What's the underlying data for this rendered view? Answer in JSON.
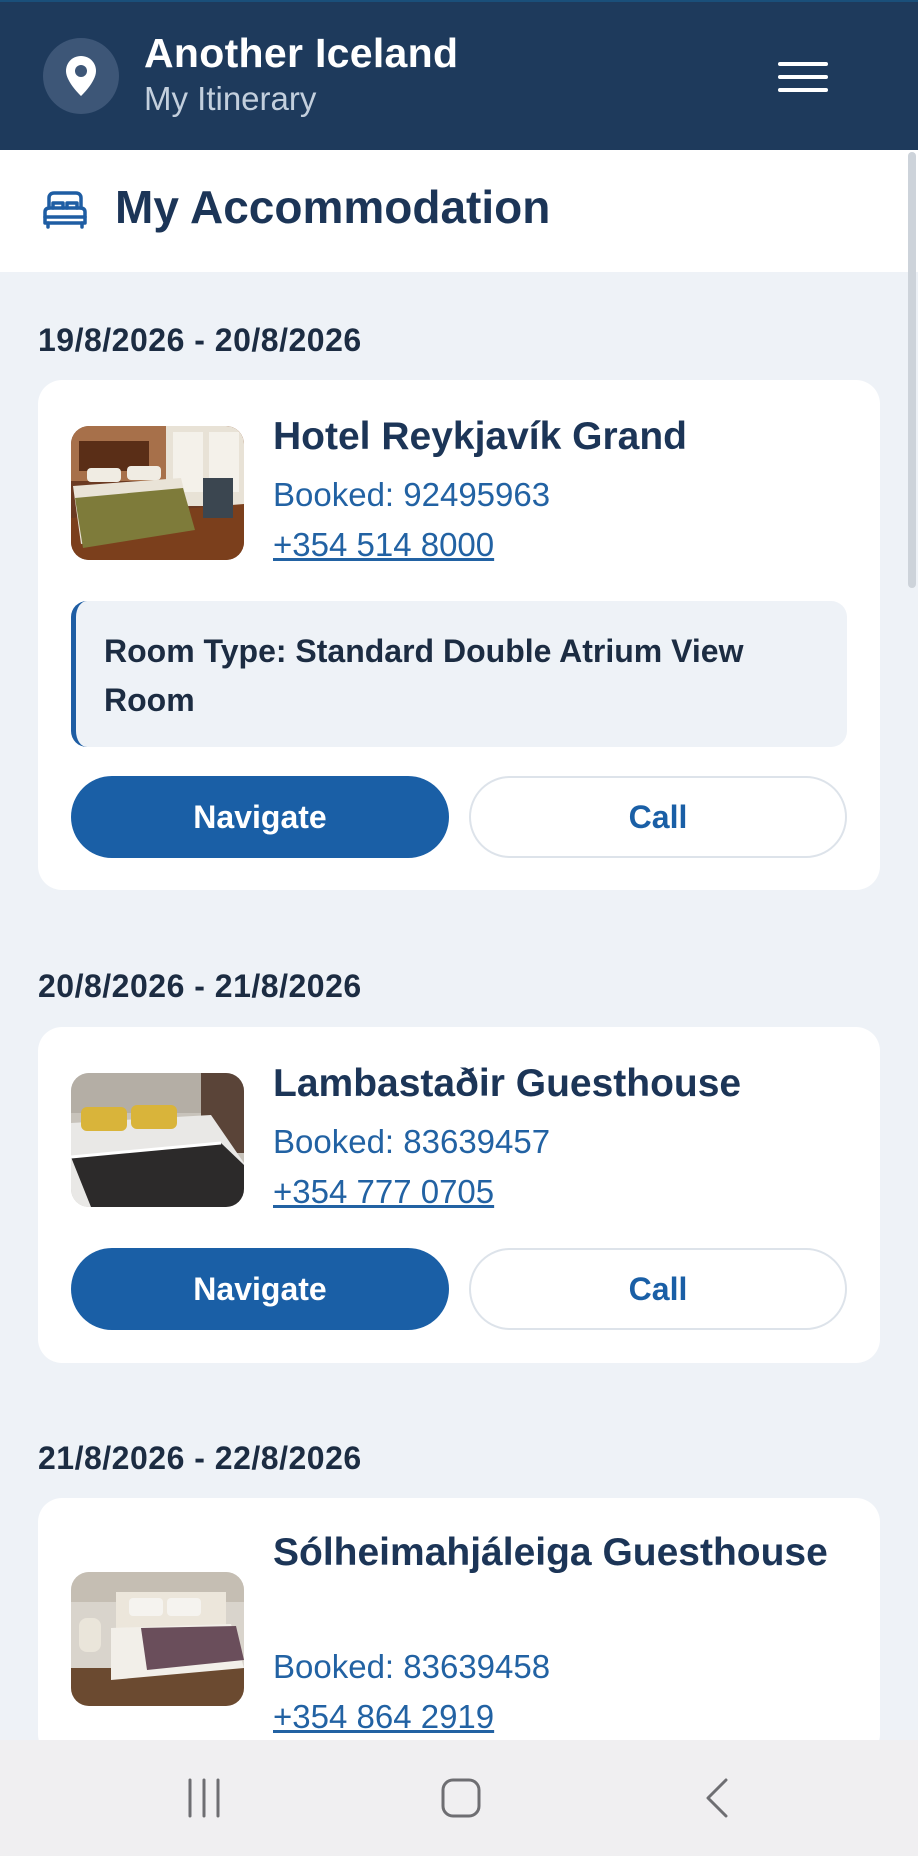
{
  "header": {
    "title": "Another Iceland",
    "subtitle": "My Itinerary",
    "logo_icon": "location-pin-icon",
    "menu_icon": "hamburger-menu-icon"
  },
  "section": {
    "title": "My Accommodation",
    "icon": "bed-icon"
  },
  "stays": [
    {
      "dates": "19/8/2026 - 20/8/2026",
      "name": "Hotel Reykjavík Grand",
      "booked": "Booked: 92495963",
      "phone": "+354 514 8000",
      "room_type": "Room Type: Standard Double Atrium View Room",
      "navigate_label": "Navigate",
      "call_label": "Call"
    },
    {
      "dates": "20/8/2026 - 21/8/2026",
      "name": "Lambastaðir Guesthouse",
      "booked": "Booked: 83639457",
      "phone": "+354 777 0705",
      "navigate_label": "Navigate",
      "call_label": "Call"
    },
    {
      "dates": "21/8/2026 - 22/8/2026",
      "name": "Sólheimahjáleiga Guesthouse",
      "booked": "Booked: 83639458",
      "phone": "+354 864 2919"
    }
  ],
  "system_nav": {
    "recents_icon": "recent-apps-icon",
    "home_icon": "home-icon",
    "back_icon": "back-icon"
  },
  "colors": {
    "header_bg": "#1e3a5c",
    "accent": "#1a5fa6",
    "page_bg": "#eef2f7"
  }
}
